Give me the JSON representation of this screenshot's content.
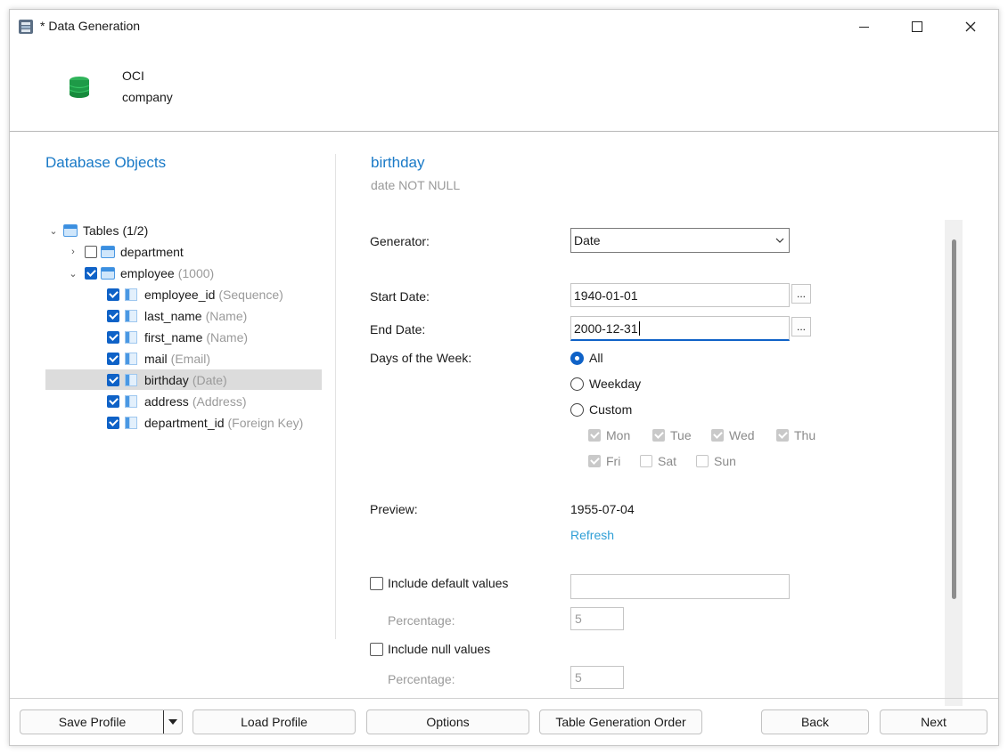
{
  "window": {
    "title": "* Data Generation",
    "controls": {
      "minimize": "—",
      "maximize": "☐",
      "close": "✕"
    }
  },
  "connection": {
    "name": "OCI",
    "database": "company"
  },
  "objects_panel": {
    "heading": "Database Objects",
    "tables_node": {
      "label": "Tables",
      "count": "(1/2)"
    },
    "tables": [
      {
        "name": "department",
        "checked": false,
        "expanded": false
      },
      {
        "name": "employee",
        "rows": "(1000)",
        "checked": true,
        "expanded": true,
        "columns": [
          {
            "name": "employee_id",
            "generator": "(Sequence)"
          },
          {
            "name": "last_name",
            "generator": "(Name)"
          },
          {
            "name": "first_name",
            "generator": "(Name)"
          },
          {
            "name": "mail",
            "generator": "(Email)"
          },
          {
            "name": "birthday",
            "generator": "(Date)",
            "selected": true
          },
          {
            "name": "address",
            "generator": "(Address)"
          },
          {
            "name": "department_id",
            "generator": "(Foreign Key)"
          }
        ]
      }
    ]
  },
  "details": {
    "column_name": "birthday",
    "column_type": "date NOT NULL",
    "generator_label": "Generator:",
    "generator_value": "Date",
    "start_date_label": "Start Date:",
    "start_date_value": "1940-01-01",
    "end_date_label": "End Date:",
    "end_date_value": "2000-12-31",
    "ellipsis": "...",
    "days_label": "Days of the Week:",
    "day_options": [
      "All",
      "Weekday",
      "Custom"
    ],
    "selected_day_option": "All",
    "days": [
      "Mon",
      "Tue",
      "Wed",
      "Thu",
      "Fri",
      "Sat",
      "Sun"
    ],
    "preview_label": "Preview:",
    "preview_value": "1955-07-04",
    "refresh_label": "Refresh",
    "include_default_label": "Include default values",
    "include_default_value": "",
    "percentage_label": "Percentage:",
    "default_percentage": "5",
    "include_null_label": "Include null values",
    "null_percentage": "5"
  },
  "footer": {
    "save_profile": "Save Profile",
    "load_profile": "Load Profile",
    "options": "Options",
    "table_generation_order": "Table Generation Order",
    "back": "Back",
    "next": "Next"
  }
}
